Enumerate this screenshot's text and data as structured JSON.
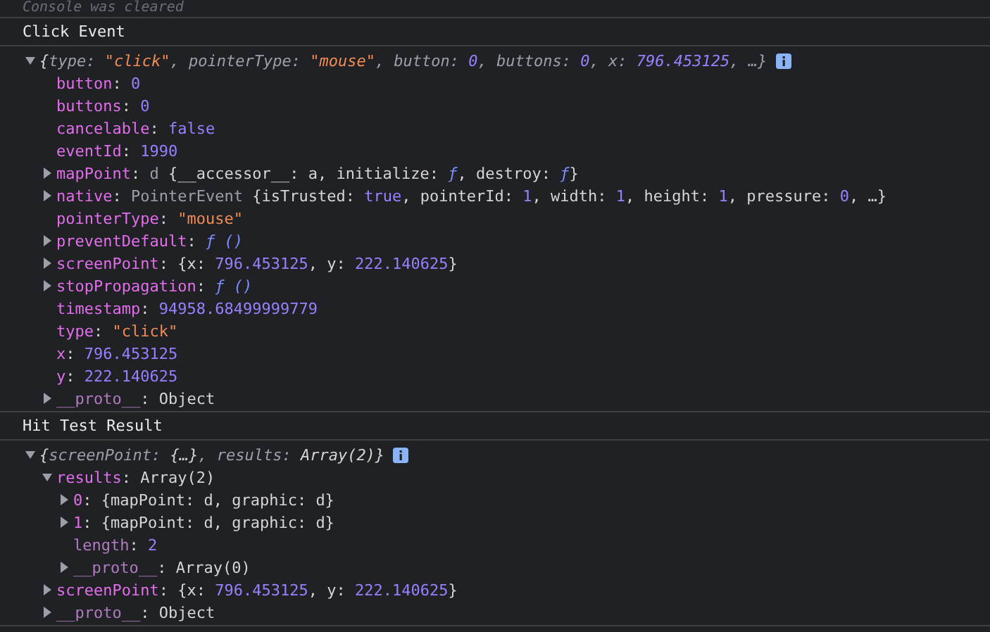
{
  "console": {
    "notice": "Console was cleared",
    "entries": [
      {
        "kind": "label",
        "text": "Click Event"
      },
      {
        "kind": "tree",
        "root": {
          "expanded": true,
          "info": true,
          "summary": [
            {
              "kind": "brace",
              "text": "{"
            },
            {
              "kind": "pkey",
              "text": "type: "
            },
            {
              "kind": "string",
              "text": "\"click\""
            },
            {
              "kind": "pkey",
              "text": ", pointerType: "
            },
            {
              "kind": "string",
              "text": "\"mouse\""
            },
            {
              "kind": "pkey",
              "text": ", button: "
            },
            {
              "kind": "number",
              "text": "0"
            },
            {
              "kind": "pkey",
              "text": ", buttons: "
            },
            {
              "kind": "number",
              "text": "0"
            },
            {
              "kind": "pkey",
              "text": ", x: "
            },
            {
              "kind": "number",
              "text": "796.453125"
            },
            {
              "kind": "pkey",
              "text": ", …}"
            }
          ],
          "children": [
            {
              "key": "button",
              "internal": false,
              "value": [
                {
                  "kind": "plain",
                  "text": ": "
                },
                {
                  "kind": "number",
                  "text": "0"
                }
              ]
            },
            {
              "key": "buttons",
              "internal": false,
              "value": [
                {
                  "kind": "plain",
                  "text": ": "
                },
                {
                  "kind": "number",
                  "text": "0"
                }
              ]
            },
            {
              "key": "cancelable",
              "internal": false,
              "value": [
                {
                  "kind": "plain",
                  "text": ": "
                },
                {
                  "kind": "number",
                  "text": "false"
                }
              ]
            },
            {
              "key": "eventId",
              "internal": false,
              "value": [
                {
                  "kind": "plain",
                  "text": ": "
                },
                {
                  "kind": "number",
                  "text": "1990"
                }
              ]
            },
            {
              "key": "mapPoint",
              "internal": false,
              "expanded": false,
              "value": [
                {
                  "kind": "plain",
                  "text": ": "
                },
                {
                  "kind": "dim",
                  "text": "d "
                },
                {
                  "kind": "plain",
                  "text": "{__accessor__: a, initialize: "
                },
                {
                  "kind": "func",
                  "text": "ƒ"
                },
                {
                  "kind": "plain",
                  "text": ", destroy: "
                },
                {
                  "kind": "func",
                  "text": "ƒ"
                },
                {
                  "kind": "plain",
                  "text": "}"
                }
              ]
            },
            {
              "key": "native",
              "internal": false,
              "expanded": false,
              "value": [
                {
                  "kind": "plain",
                  "text": ": "
                },
                {
                  "kind": "dim",
                  "text": "PointerEvent "
                },
                {
                  "kind": "plain",
                  "text": "{isTrusted: "
                },
                {
                  "kind": "number",
                  "text": "true"
                },
                {
                  "kind": "plain",
                  "text": ", pointerId: "
                },
                {
                  "kind": "number",
                  "text": "1"
                },
                {
                  "kind": "plain",
                  "text": ", width: "
                },
                {
                  "kind": "number",
                  "text": "1"
                },
                {
                  "kind": "plain",
                  "text": ", height: "
                },
                {
                  "kind": "number",
                  "text": "1"
                },
                {
                  "kind": "plain",
                  "text": ", pressure: "
                },
                {
                  "kind": "number",
                  "text": "0"
                },
                {
                  "kind": "plain",
                  "text": ", …}"
                }
              ]
            },
            {
              "key": "pointerType",
              "internal": false,
              "value": [
                {
                  "kind": "plain",
                  "text": ": "
                },
                {
                  "kind": "string",
                  "text": "\"mouse\""
                }
              ]
            },
            {
              "key": "preventDefault",
              "internal": false,
              "expanded": false,
              "value": [
                {
                  "kind": "plain",
                  "text": ": "
                },
                {
                  "kind": "func",
                  "text": "ƒ ()"
                }
              ]
            },
            {
              "key": "screenPoint",
              "internal": false,
              "expanded": false,
              "value": [
                {
                  "kind": "plain",
                  "text": ": {x: "
                },
                {
                  "kind": "number",
                  "text": "796.453125"
                },
                {
                  "kind": "plain",
                  "text": ", y: "
                },
                {
                  "kind": "number",
                  "text": "222.140625"
                },
                {
                  "kind": "plain",
                  "text": "}"
                }
              ]
            },
            {
              "key": "stopPropagation",
              "internal": false,
              "expanded": false,
              "value": [
                {
                  "kind": "plain",
                  "text": ": "
                },
                {
                  "kind": "func",
                  "text": "ƒ ()"
                }
              ]
            },
            {
              "key": "timestamp",
              "internal": false,
              "value": [
                {
                  "kind": "plain",
                  "text": ": "
                },
                {
                  "kind": "number",
                  "text": "94958.68499999779"
                }
              ]
            },
            {
              "key": "type",
              "internal": false,
              "value": [
                {
                  "kind": "plain",
                  "text": ": "
                },
                {
                  "kind": "string",
                  "text": "\"click\""
                }
              ]
            },
            {
              "key": "x",
              "internal": false,
              "value": [
                {
                  "kind": "plain",
                  "text": ": "
                },
                {
                  "kind": "number",
                  "text": "796.453125"
                }
              ]
            },
            {
              "key": "y",
              "internal": false,
              "value": [
                {
                  "kind": "plain",
                  "text": ": "
                },
                {
                  "kind": "number",
                  "text": "222.140625"
                }
              ]
            },
            {
              "key": "__proto__",
              "internal": true,
              "expanded": false,
              "value": [
                {
                  "kind": "plain",
                  "text": ": Object"
                }
              ]
            }
          ]
        }
      },
      {
        "kind": "label",
        "text": "Hit Test Result"
      },
      {
        "kind": "tree",
        "root": {
          "expanded": true,
          "info": true,
          "summary": [
            {
              "kind": "brace",
              "text": "{"
            },
            {
              "kind": "pkey",
              "text": "screenPoint: "
            },
            {
              "kind": "brace",
              "text": "{…}"
            },
            {
              "kind": "pkey",
              "text": ", results: "
            },
            {
              "kind": "brace",
              "text": "Array(2)}"
            }
          ],
          "children": [
            {
              "key": "results",
              "internal": false,
              "expanded": true,
              "value": [
                {
                  "kind": "plain",
                  "text": ": Array(2)"
                }
              ],
              "children": [
                {
                  "key": "0",
                  "internal": false,
                  "expanded": false,
                  "value": [
                    {
                      "kind": "plain",
                      "text": ": {mapPoint: d, graphic: d}"
                    }
                  ]
                },
                {
                  "key": "1",
                  "internal": false,
                  "expanded": false,
                  "value": [
                    {
                      "kind": "plain",
                      "text": ": {mapPoint: d, graphic: d}"
                    }
                  ]
                },
                {
                  "key": "length",
                  "internal": true,
                  "value": [
                    {
                      "kind": "plain",
                      "text": ": "
                    },
                    {
                      "kind": "number",
                      "text": "2"
                    }
                  ]
                },
                {
                  "key": "__proto__",
                  "internal": true,
                  "expanded": false,
                  "value": [
                    {
                      "kind": "plain",
                      "text": ": Array(0)"
                    }
                  ]
                }
              ]
            },
            {
              "key": "screenPoint",
              "internal": false,
              "expanded": false,
              "value": [
                {
                  "kind": "plain",
                  "text": ": {x: "
                },
                {
                  "kind": "number",
                  "text": "796.453125"
                },
                {
                  "kind": "plain",
                  "text": ", y: "
                },
                {
                  "kind": "number",
                  "text": "222.140625"
                },
                {
                  "kind": "plain",
                  "text": "}"
                }
              ]
            },
            {
              "key": "__proto__",
              "internal": true,
              "expanded": false,
              "value": [
                {
                  "kind": "plain",
                  "text": ": Object"
                }
              ]
            }
          ]
        }
      }
    ]
  }
}
